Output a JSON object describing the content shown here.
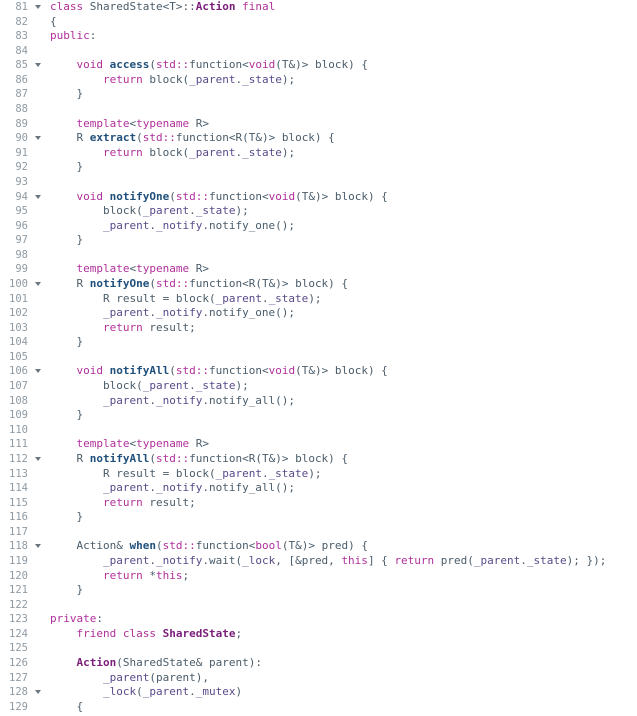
{
  "editor": {
    "language": "cpp",
    "colors": {
      "background": "#ffffff",
      "line_number": "#8f9aa3",
      "default_text": "#4a5c6a",
      "keyword": "#b0309a",
      "function_name": "#1f4f7a",
      "class_name": "#7a1e7a",
      "identifier": "#5a4a8a"
    },
    "lines": [
      {
        "num": "81",
        "fold": true,
        "tokens": [
          [
            "k",
            "class "
          ],
          [
            "p",
            "SharedState<T>::"
          ],
          [
            "cls",
            "Action"
          ],
          [
            "k",
            " final"
          ]
        ]
      },
      {
        "num": "82",
        "fold": false,
        "tokens": [
          [
            "p",
            "{"
          ]
        ]
      },
      {
        "num": "83",
        "fold": false,
        "tokens": [
          [
            "k",
            "public"
          ],
          [
            "p",
            ":"
          ]
        ]
      },
      {
        "num": "84",
        "fold": false,
        "tokens": []
      },
      {
        "num": "85",
        "fold": true,
        "tokens": [
          [
            "p",
            "    "
          ],
          [
            "k",
            "void "
          ],
          [
            "fn",
            "access"
          ],
          [
            "p",
            "("
          ],
          [
            "ns",
            "std::"
          ],
          [
            "p",
            "function<"
          ],
          [
            "k",
            "void"
          ],
          [
            "p",
            "(T&)> block) {"
          ]
        ]
      },
      {
        "num": "86",
        "fold": false,
        "tokens": [
          [
            "p",
            "        "
          ],
          [
            "k",
            "return "
          ],
          [
            "p",
            "block("
          ],
          [
            "id",
            "_parent"
          ],
          [
            "p",
            "."
          ],
          [
            "id",
            "_state"
          ],
          [
            "p",
            ");"
          ]
        ]
      },
      {
        "num": "87",
        "fold": false,
        "tokens": [
          [
            "p",
            "    }"
          ]
        ]
      },
      {
        "num": "88",
        "fold": false,
        "tokens": []
      },
      {
        "num": "89",
        "fold": false,
        "tokens": [
          [
            "p",
            "    "
          ],
          [
            "k",
            "template"
          ],
          [
            "p",
            "<"
          ],
          [
            "k",
            "typename "
          ],
          [
            "p",
            "R>"
          ]
        ]
      },
      {
        "num": "90",
        "fold": true,
        "tokens": [
          [
            "p",
            "    R "
          ],
          [
            "fn",
            "extract"
          ],
          [
            "p",
            "("
          ],
          [
            "ns",
            "std::"
          ],
          [
            "p",
            "function<R(T&)> block) {"
          ]
        ]
      },
      {
        "num": "91",
        "fold": false,
        "tokens": [
          [
            "p",
            "        "
          ],
          [
            "k",
            "return "
          ],
          [
            "p",
            "block("
          ],
          [
            "id",
            "_parent"
          ],
          [
            "p",
            "."
          ],
          [
            "id",
            "_state"
          ],
          [
            "p",
            ");"
          ]
        ]
      },
      {
        "num": "92",
        "fold": false,
        "tokens": [
          [
            "p",
            "    }"
          ]
        ]
      },
      {
        "num": "93",
        "fold": false,
        "tokens": []
      },
      {
        "num": "94",
        "fold": true,
        "tokens": [
          [
            "p",
            "    "
          ],
          [
            "k",
            "void "
          ],
          [
            "fn",
            "notifyOne"
          ],
          [
            "p",
            "("
          ],
          [
            "ns",
            "std::"
          ],
          [
            "p",
            "function<"
          ],
          [
            "k",
            "void"
          ],
          [
            "p",
            "(T&)> block) {"
          ]
        ]
      },
      {
        "num": "95",
        "fold": false,
        "tokens": [
          [
            "p",
            "        block("
          ],
          [
            "id",
            "_parent"
          ],
          [
            "p",
            "."
          ],
          [
            "id",
            "_state"
          ],
          [
            "p",
            ");"
          ]
        ]
      },
      {
        "num": "96",
        "fold": false,
        "tokens": [
          [
            "p",
            "        "
          ],
          [
            "id",
            "_parent"
          ],
          [
            "p",
            "."
          ],
          [
            "id",
            "_notify"
          ],
          [
            "p",
            ".notify_one();"
          ]
        ]
      },
      {
        "num": "97",
        "fold": false,
        "tokens": [
          [
            "p",
            "    }"
          ]
        ]
      },
      {
        "num": "98",
        "fold": false,
        "tokens": []
      },
      {
        "num": "99",
        "fold": false,
        "tokens": [
          [
            "p",
            "    "
          ],
          [
            "k",
            "template"
          ],
          [
            "p",
            "<"
          ],
          [
            "k",
            "typename "
          ],
          [
            "p",
            "R>"
          ]
        ]
      },
      {
        "num": "100",
        "fold": true,
        "tokens": [
          [
            "p",
            "    R "
          ],
          [
            "fn",
            "notifyOne"
          ],
          [
            "p",
            "("
          ],
          [
            "ns",
            "std::"
          ],
          [
            "p",
            "function<R(T&)> block) {"
          ]
        ]
      },
      {
        "num": "101",
        "fold": false,
        "tokens": [
          [
            "p",
            "        R result = block("
          ],
          [
            "id",
            "_parent"
          ],
          [
            "p",
            "."
          ],
          [
            "id",
            "_state"
          ],
          [
            "p",
            ");"
          ]
        ]
      },
      {
        "num": "102",
        "fold": false,
        "tokens": [
          [
            "p",
            "        "
          ],
          [
            "id",
            "_parent"
          ],
          [
            "p",
            "."
          ],
          [
            "id",
            "_notify"
          ],
          [
            "p",
            ".notify_one();"
          ]
        ]
      },
      {
        "num": "103",
        "fold": false,
        "tokens": [
          [
            "p",
            "        "
          ],
          [
            "k",
            "return "
          ],
          [
            "p",
            "result;"
          ]
        ]
      },
      {
        "num": "104",
        "fold": false,
        "tokens": [
          [
            "p",
            "    }"
          ]
        ]
      },
      {
        "num": "105",
        "fold": false,
        "tokens": []
      },
      {
        "num": "106",
        "fold": true,
        "tokens": [
          [
            "p",
            "    "
          ],
          [
            "k",
            "void "
          ],
          [
            "fn",
            "notifyAll"
          ],
          [
            "p",
            "("
          ],
          [
            "ns",
            "std::"
          ],
          [
            "p",
            "function<"
          ],
          [
            "k",
            "void"
          ],
          [
            "p",
            "(T&)> block) {"
          ]
        ]
      },
      {
        "num": "107",
        "fold": false,
        "tokens": [
          [
            "p",
            "        block("
          ],
          [
            "id",
            "_parent"
          ],
          [
            "p",
            "."
          ],
          [
            "id",
            "_state"
          ],
          [
            "p",
            ");"
          ]
        ]
      },
      {
        "num": "108",
        "fold": false,
        "tokens": [
          [
            "p",
            "        "
          ],
          [
            "id",
            "_parent"
          ],
          [
            "p",
            "."
          ],
          [
            "id",
            "_notify"
          ],
          [
            "p",
            ".notify_all();"
          ]
        ]
      },
      {
        "num": "109",
        "fold": false,
        "tokens": [
          [
            "p",
            "    }"
          ]
        ]
      },
      {
        "num": "110",
        "fold": false,
        "tokens": []
      },
      {
        "num": "111",
        "fold": false,
        "tokens": [
          [
            "p",
            "    "
          ],
          [
            "k",
            "template"
          ],
          [
            "p",
            "<"
          ],
          [
            "k",
            "typename "
          ],
          [
            "p",
            "R>"
          ]
        ]
      },
      {
        "num": "112",
        "fold": true,
        "tokens": [
          [
            "p",
            "    R "
          ],
          [
            "fn",
            "notifyAll"
          ],
          [
            "p",
            "("
          ],
          [
            "ns",
            "std::"
          ],
          [
            "p",
            "function<R(T&)> block) {"
          ]
        ]
      },
      {
        "num": "113",
        "fold": false,
        "tokens": [
          [
            "p",
            "        R result = block("
          ],
          [
            "id",
            "_parent"
          ],
          [
            "p",
            "."
          ],
          [
            "id",
            "_state"
          ],
          [
            "p",
            ");"
          ]
        ]
      },
      {
        "num": "114",
        "fold": false,
        "tokens": [
          [
            "p",
            "        "
          ],
          [
            "id",
            "_parent"
          ],
          [
            "p",
            "."
          ],
          [
            "id",
            "_notify"
          ],
          [
            "p",
            ".notify_all();"
          ]
        ]
      },
      {
        "num": "115",
        "fold": false,
        "tokens": [
          [
            "p",
            "        "
          ],
          [
            "k",
            "return "
          ],
          [
            "p",
            "result;"
          ]
        ]
      },
      {
        "num": "116",
        "fold": false,
        "tokens": [
          [
            "p",
            "    }"
          ]
        ]
      },
      {
        "num": "117",
        "fold": false,
        "tokens": []
      },
      {
        "num": "118",
        "fold": true,
        "tokens": [
          [
            "p",
            "    Action& "
          ],
          [
            "fn",
            "when"
          ],
          [
            "p",
            "("
          ],
          [
            "ns",
            "std::"
          ],
          [
            "p",
            "function<"
          ],
          [
            "k",
            "bool"
          ],
          [
            "p",
            "(T&)> pred) {"
          ]
        ]
      },
      {
        "num": "119",
        "fold": false,
        "tokens": [
          [
            "p",
            "        "
          ],
          [
            "id",
            "_parent"
          ],
          [
            "p",
            "."
          ],
          [
            "id",
            "_notify"
          ],
          [
            "p",
            ".wait("
          ],
          [
            "id",
            "_lock"
          ],
          [
            "p",
            ", [&pred, "
          ],
          [
            "k",
            "this"
          ],
          [
            "p",
            "] { "
          ],
          [
            "k",
            "return "
          ],
          [
            "p",
            "pred("
          ],
          [
            "id",
            "_parent"
          ],
          [
            "p",
            "."
          ],
          [
            "id",
            "_state"
          ],
          [
            "p",
            "); });"
          ]
        ]
      },
      {
        "num": "120",
        "fold": false,
        "tokens": [
          [
            "p",
            "        "
          ],
          [
            "k",
            "return "
          ],
          [
            "p",
            "*"
          ],
          [
            "k",
            "this"
          ],
          [
            "p",
            ";"
          ]
        ]
      },
      {
        "num": "121",
        "fold": false,
        "tokens": [
          [
            "p",
            "    }"
          ]
        ]
      },
      {
        "num": "122",
        "fold": false,
        "tokens": []
      },
      {
        "num": "123",
        "fold": false,
        "tokens": [
          [
            "k",
            "private"
          ],
          [
            "p",
            ":"
          ]
        ]
      },
      {
        "num": "124",
        "fold": false,
        "tokens": [
          [
            "p",
            "    "
          ],
          [
            "k",
            "friend class "
          ],
          [
            "cls",
            "SharedState"
          ],
          [
            "p",
            ";"
          ]
        ]
      },
      {
        "num": "125",
        "fold": false,
        "tokens": []
      },
      {
        "num": "126",
        "fold": false,
        "tokens": [
          [
            "p",
            "    "
          ],
          [
            "cls",
            "Action"
          ],
          [
            "p",
            "(SharedState& parent):"
          ]
        ]
      },
      {
        "num": "127",
        "fold": false,
        "tokens": [
          [
            "p",
            "        "
          ],
          [
            "id",
            "_parent"
          ],
          [
            "p",
            "(parent),"
          ]
        ]
      },
      {
        "num": "128",
        "fold": true,
        "tokens": [
          [
            "p",
            "        "
          ],
          [
            "id",
            "_lock"
          ],
          [
            "p",
            "("
          ],
          [
            "id",
            "_parent"
          ],
          [
            "p",
            "."
          ],
          [
            "id",
            "_mutex"
          ],
          [
            "p",
            ")"
          ]
        ]
      },
      {
        "num": "129",
        "fold": false,
        "tokens": [
          [
            "p",
            "    {"
          ]
        ]
      }
    ]
  }
}
